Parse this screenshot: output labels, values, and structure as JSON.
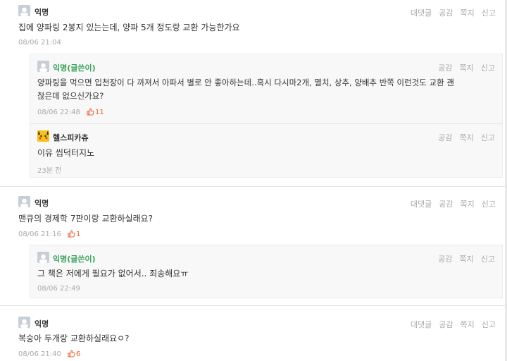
{
  "actions": {
    "reply": "대댓글",
    "like": "공감",
    "message": "쪽지",
    "report": "신고"
  },
  "threads": [
    {
      "author": "익명",
      "text": "집에 양파링 2봉지 있는는데, 양파 5개 정도랑 교환 가능한가요",
      "time": "08/06 21:04",
      "likes": "",
      "replies": [
        {
          "author": "익명(글쓴이)",
          "text_line1": "양파링을 먹으면 입천장이 다 까져서 아파서 별로 안 좋아하는데..혹시 다시마2개, 멸치, 상추, 양배추 반쪽 이런것도 교환 괜",
          "text_line2": "찮은데 없으신가요?",
          "time": "08/06 22:48",
          "likes": "11"
        },
        {
          "author": "헬스피카츄",
          "text": "이유 씹덕터지노",
          "time": "23분 전",
          "likes": ""
        }
      ]
    },
    {
      "author": "익명",
      "text": "맨큐의 경제학 7판이랑 교환하실래요?",
      "time": "08/06 21:16",
      "likes": "1",
      "replies": [
        {
          "author": "익명(글쓴이)",
          "text": "그 책은 저에게 필요가 없어서.. 죄송해요ㅠ",
          "time": "08/06 22:49",
          "likes": ""
        }
      ]
    },
    {
      "author": "익명",
      "text": "복숭아 두개랑 교환하실래요ㅇ?",
      "time": "08/06 21:40",
      "likes": "6",
      "replies": []
    }
  ],
  "colors": {
    "op_author": "#3aa35b",
    "likes": "#e8612c",
    "muted": "#aaaaaa"
  },
  "icons": {
    "avatar": "default-avatar-icon",
    "pikachu": "pikachu-avatar-icon",
    "like": "thumbs-up-icon"
  }
}
